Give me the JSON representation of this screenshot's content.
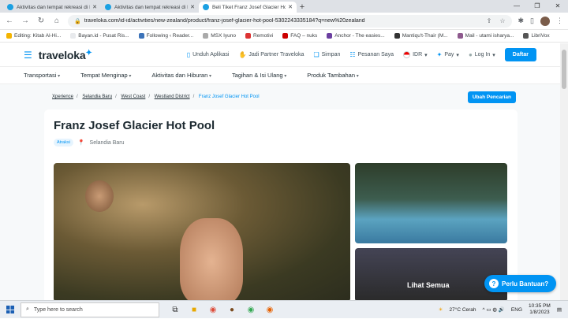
{
  "browser": {
    "tabs": [
      {
        "title": "Aktivitas dan tempat rekreasi di I",
        "active": false
      },
      {
        "title": "Aktivitas dan tempat rekreasi di I",
        "active": false
      },
      {
        "title": "Beli Tiket Franz Josef Glacier Hot",
        "active": true
      }
    ],
    "url": "traveloka.com/id-id/activities/new-zealand/product/franz-josef-glacier-hot-pool-5302243335184?q=new%20zealand",
    "bookmarks": [
      "Editing: Kitab Al-Hi...",
      "Bayan.id - Pusat Ris...",
      "Following ‹ Reader...",
      "MSX Iyuno",
      "Remotivi",
      "FAQ – nuks",
      "Anchor - The easies...",
      "Mantiqu't-Thair (M...",
      "Mail - utami isharya...",
      "LibriVox"
    ]
  },
  "site": {
    "logo": "traveloka",
    "header_links": [
      "Unduh Aplikasi",
      "Jadi Partner Traveloka",
      "Simpan",
      "Pesanan Saya"
    ],
    "currency": "IDR",
    "pay": "Pay",
    "login": "Log In",
    "register": "Daftar",
    "menu": [
      "Transportasi",
      "Tempat Menginap",
      "Aktivitas dan Hiburan",
      "Tagihan & Isi Ulang",
      "Produk Tambahan"
    ],
    "breadcrumbs": [
      "Xperience",
      "Selandia Baru",
      "West Coast",
      "Westland District"
    ],
    "breadcrumb_current": "Franz Josef Glacier Hot Pool",
    "change_search": "Ubah Pencarian",
    "product_title": "Franz Josef Glacier Hot Pool",
    "category_badge": "Atraksi",
    "location": "Selandia Baru",
    "see_all": "Lihat Semua",
    "help": "Perlu Bantuan?"
  },
  "taskbar": {
    "search_placeholder": "Type here to search",
    "weather": "27°C  Cerah",
    "lang": "ENG",
    "time": "10:35 PM",
    "date": "1/8/2023"
  },
  "colors": {
    "brand": "#0194f3"
  }
}
